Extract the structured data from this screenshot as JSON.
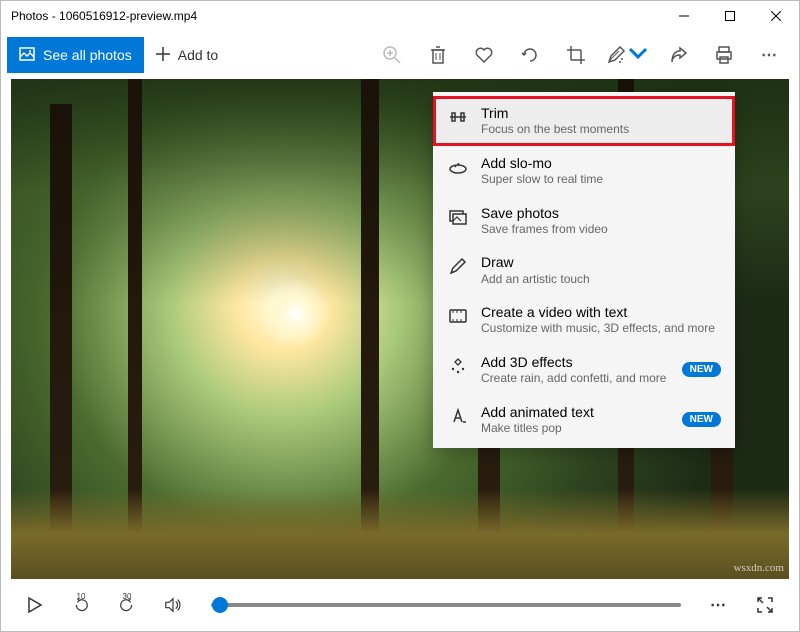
{
  "window_title": "Photos - 1060516912-preview.mp4",
  "toolbar": {
    "see_all_label": "See all photos",
    "add_to_label": "Add to"
  },
  "edit_menu": {
    "items": [
      {
        "title": "Trim",
        "subtitle": "Focus on the best moments",
        "badge": "",
        "highlighted": true
      },
      {
        "title": "Add slo-mo",
        "subtitle": "Super slow to real time",
        "badge": ""
      },
      {
        "title": "Save photos",
        "subtitle": "Save frames from video",
        "badge": ""
      },
      {
        "title": "Draw",
        "subtitle": "Add an artistic touch",
        "badge": ""
      },
      {
        "title": "Create a video with text",
        "subtitle": "Customize with music, 3D effects, and more",
        "badge": ""
      },
      {
        "title": "Add 3D effects",
        "subtitle": "Create rain, add confetti, and more",
        "badge": "NEW"
      },
      {
        "title": "Add animated text",
        "subtitle": "Make titles pop",
        "badge": "NEW"
      }
    ]
  },
  "playback": {
    "skip_back": "10",
    "skip_fwd": "30"
  },
  "watermark": "wsxdn.com"
}
